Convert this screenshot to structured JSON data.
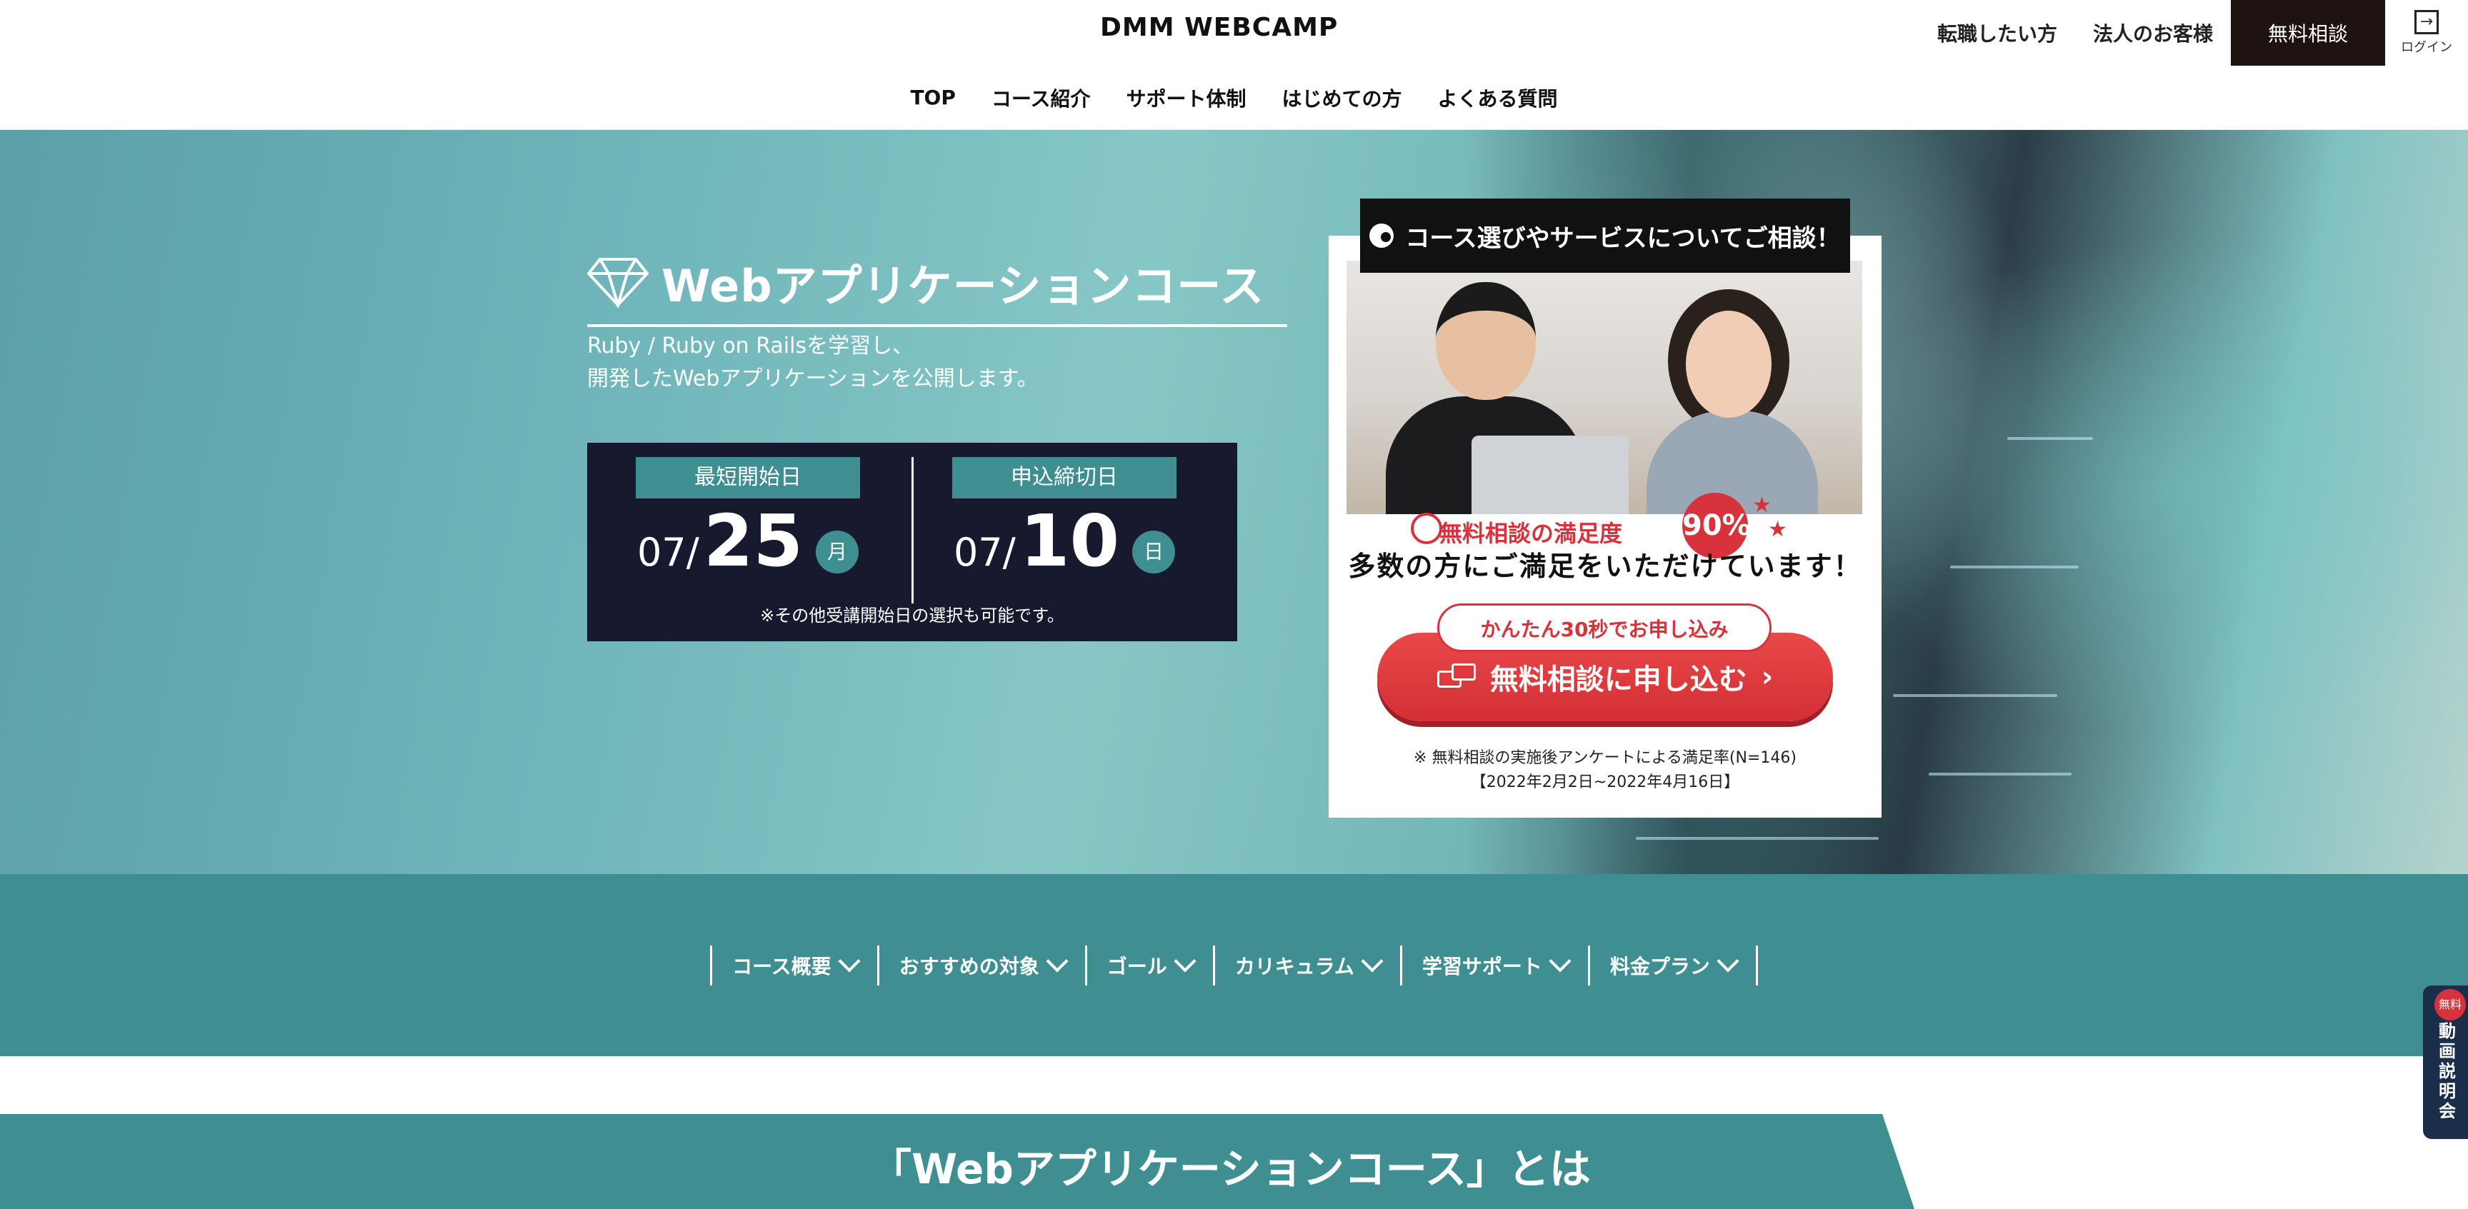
{
  "header": {
    "logo": "DMM WEBCAMP",
    "links": [
      "転職したい方",
      "法人のお客様"
    ],
    "cta": "無料相談",
    "login_label": "ログイン"
  },
  "nav": [
    "TOP",
    "コース紹介",
    "サポート体制",
    "はじめての方",
    "よくある質問"
  ],
  "hero": {
    "course_title": "Webアプリケーションコース",
    "desc_line1": "Ruby / Ruby on Railsを学習し、",
    "desc_line2": "開発したWebアプリケーションを公開します。",
    "dates": [
      {
        "label": "最短開始日",
        "month": "07/",
        "day": "25",
        "dow": "月"
      },
      {
        "label": "申込締切日",
        "month": "07/",
        "day": "10",
        "dow": "日"
      }
    ],
    "date_note": "※その他受講開始日の選択も可能です。"
  },
  "consult": {
    "heading": "コース選びやサービスについてご相談！",
    "satisfaction_label": "無料相談の満足度",
    "satisfaction_value": "90%",
    "tagline": "多数の方にご満足をいただけています！",
    "pill": "かんたん30秒でお申し込み",
    "button": "無料相談に申し込む",
    "note_line1": "※ 無料相談の実施後アンケートによる満足率(N=146)",
    "note_line2": "【2022年2月2日~2022年4月16日】"
  },
  "section_nav": [
    "コース概要",
    "おすすめの対象",
    "ゴール",
    "カリキュラム",
    "学習サポート",
    "料金プラン"
  ],
  "banner": {
    "title": "「Webアプリケーションコース」とは"
  },
  "video_tab": {
    "badge": "無料",
    "label": "動画説明会"
  },
  "colors": {
    "teal": "#3f8e91",
    "navy": "#171a2e",
    "red": "#d8333d",
    "dark": "#1f1311"
  }
}
